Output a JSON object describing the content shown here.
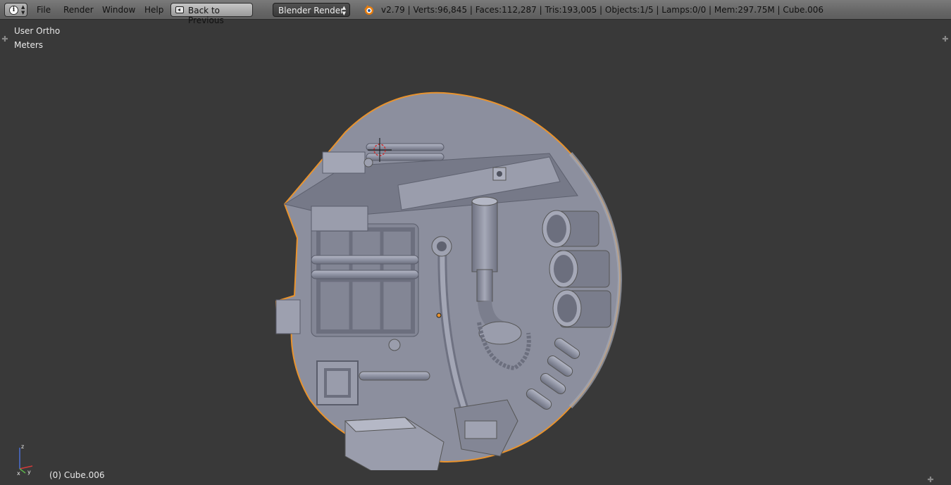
{
  "header": {
    "editor_type_icon": "info-icon",
    "menus": [
      "File",
      "Render",
      "Window",
      "Help"
    ],
    "back_button_label": "Back to Previous",
    "render_engine": "Blender Render",
    "stats": "v2.79 | Verts:96,845 | Faces:112,287 | Tris:193,005 | Objects:1/5 | Lamps:0/0 | Mem:297.75M | Cube.006"
  },
  "viewport": {
    "view_name": "User Ortho",
    "units": "Meters",
    "active_object": "(0) Cube.006",
    "gizmo_axes": {
      "x": "x",
      "y": "y",
      "z": "z"
    }
  },
  "colors": {
    "background": "#393939",
    "model_fill": "#8c8f9e",
    "selection_outline": "#e9932d",
    "axis_x": "#d23a3a",
    "axis_y": "#5ab34a",
    "axis_z": "#4a6fd2"
  }
}
